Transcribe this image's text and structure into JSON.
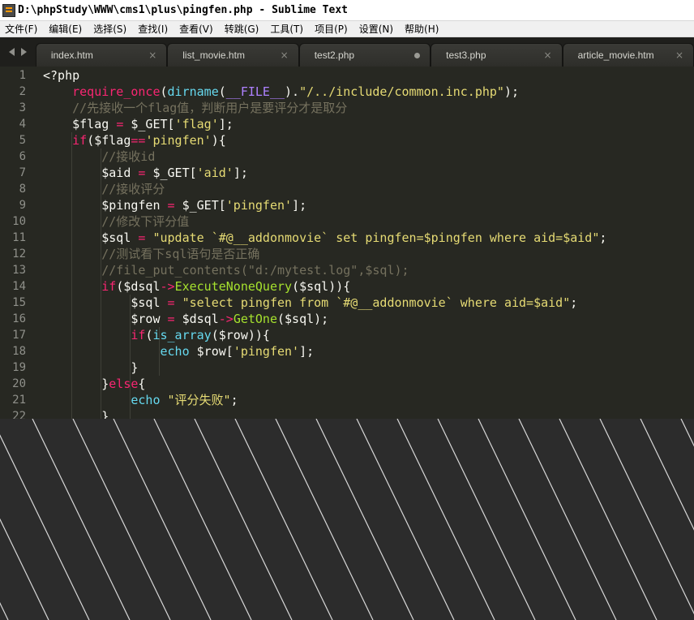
{
  "window": {
    "title": "D:\\phpStudy\\WWW\\cms1\\plus\\pingfen.php - Sublime Text"
  },
  "menu": [
    "文件(F)",
    "编辑(E)",
    "选择(S)",
    "查找(I)",
    "查看(V)",
    "转跳(G)",
    "工具(T)",
    "项目(P)",
    "设置(N)",
    "帮助(H)"
  ],
  "tabs": [
    {
      "label": "index.htm",
      "state": "close"
    },
    {
      "label": "list_movie.htm",
      "state": "close"
    },
    {
      "label": "test2.php",
      "state": "dirty"
    },
    {
      "label": "test3.php",
      "state": "close"
    },
    {
      "label": "article_movie.htm",
      "state": "close"
    }
  ],
  "tab_close_glyph": "×",
  "line_numbers": [
    "1",
    "2",
    "3",
    "4",
    "5",
    "6",
    "7",
    "8",
    "9",
    "10",
    "11",
    "12",
    "13",
    "14",
    "15",
    "16",
    "17",
    "18",
    "19",
    "20",
    "21",
    "22"
  ],
  "code_lines": [
    "<?php",
    "    require_once(dirname(__FILE__).\"/../include/common.inc.php\");",
    "    //先接收一个flag值，判断用户是要评分才是取分",
    "    $flag = $_GET['flag'];",
    "    if($flag=='pingfen'){",
    "        //接收id",
    "        $aid = $_GET['aid'];",
    "        //接收评分",
    "        $pingfen = $_GET['pingfen'];",
    "        //修改下评分值",
    "        $sql = \"update `#@__addonmovie` set pingfen=$pingfen where aid=$aid\";",
    "        //测试看下sql语句是否正确",
    "        //file_put_contents(\"d:/mytest.log\",$sql);",
    "        if($dsql->ExecuteNoneQuery($sql)){",
    "            $sql = \"select pingfen from `#@__addonmovie` where aid=$aid\";",
    "            $row = $dsql->GetOne($sql);",
    "            if(is_array($row)){",
    "                echo $row['pingfen'];",
    "            }",
    "        }else{",
    "            echo \"评分失败\";",
    "        }"
  ],
  "colors": {
    "editor_bg": "#272822",
    "keyword": "#f92672",
    "function": "#66d9ef",
    "string": "#e6db74",
    "comment": "#75715e",
    "method": "#a6e22e"
  }
}
